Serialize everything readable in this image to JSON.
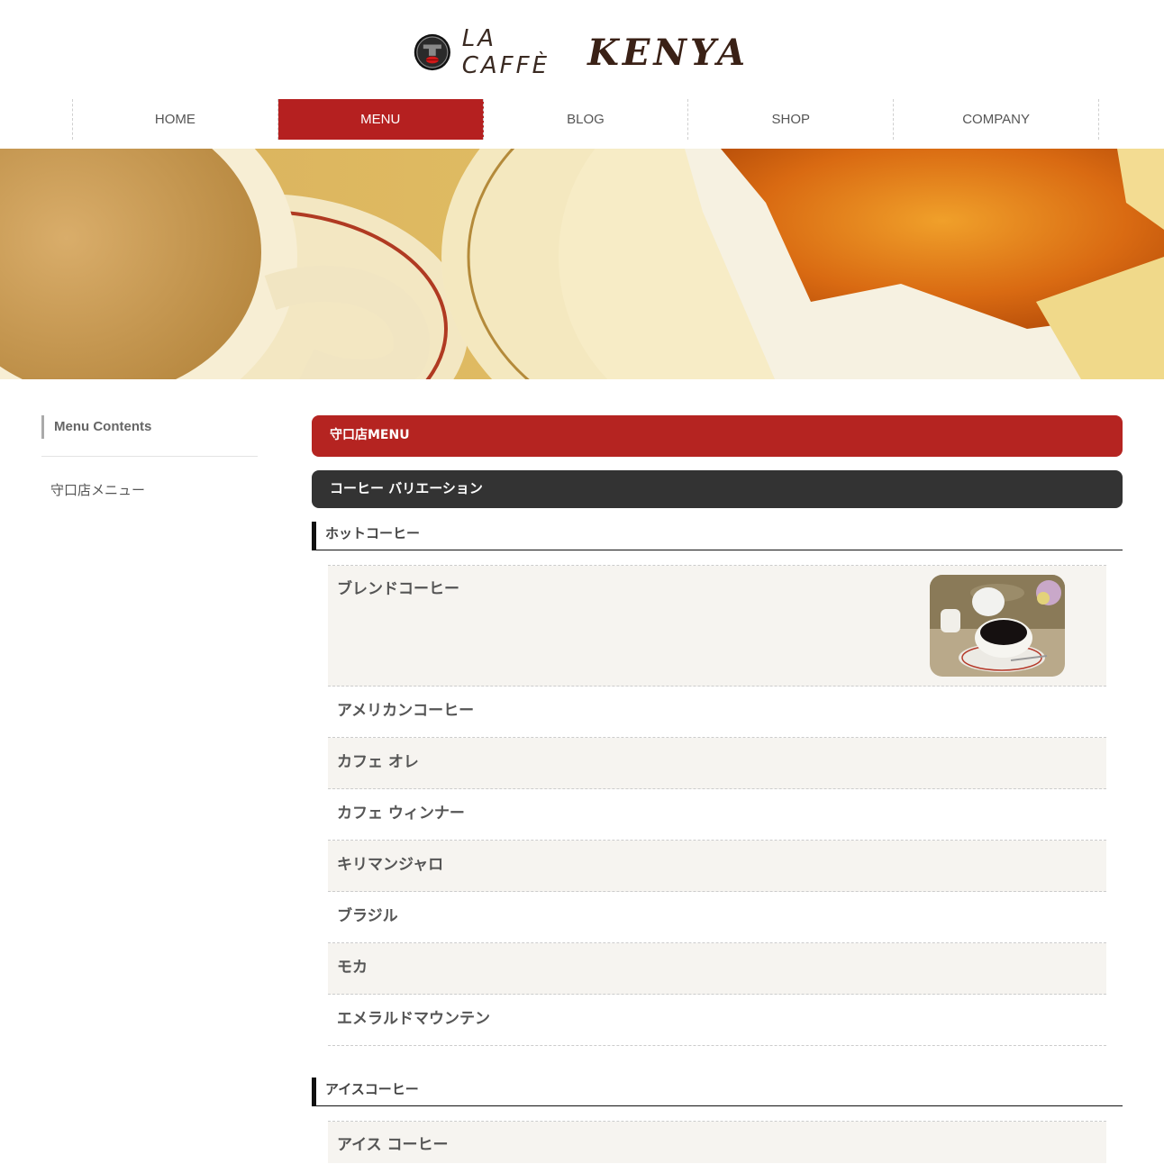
{
  "brand": {
    "text_1": "LA CAFFÈ",
    "text_2": "KENYA"
  },
  "nav": [
    {
      "label": "HOME",
      "active": false
    },
    {
      "label": "MENU",
      "active": true
    },
    {
      "label": "BLOG",
      "active": false
    },
    {
      "label": "SHOP",
      "active": false
    },
    {
      "label": "COMPANY",
      "active": false
    }
  ],
  "sidebar": {
    "heading": "Menu Contents",
    "link": "守口店メニュー"
  },
  "main": {
    "page_heading": "守口店MENU",
    "section_heading": "コーヒー バリエーション",
    "hot": {
      "heading": "ホットコーヒー",
      "items": [
        "ブレンドコーヒー",
        "アメリカンコーヒー",
        "カフェ オレ",
        "カフェ ウィンナー",
        "キリマンジャロ",
        "ブラジル",
        "モカ",
        "エメラルドマウンテン"
      ]
    },
    "iced": {
      "heading": "アイスコーヒー",
      "items": [
        "アイス コーヒー"
      ]
    }
  },
  "colors": {
    "accent_red": "#b52020",
    "dark_bar": "#333333",
    "row_alt": "#f6f4f0"
  }
}
